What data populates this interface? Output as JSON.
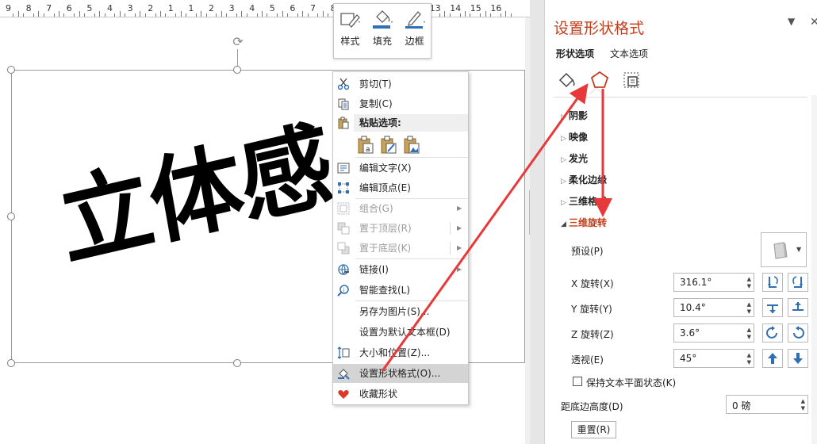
{
  "ruler": {
    "numbers": [
      "9",
      "8",
      "7",
      "6",
      "5",
      "4",
      "3",
      "2",
      "1",
      "1",
      "2",
      "3",
      "4",
      "5",
      "6",
      "7",
      "8",
      "9",
      "10",
      "11",
      "12",
      "13",
      "14",
      "15",
      "16"
    ]
  },
  "slide": {
    "art_text": "立体感"
  },
  "mini_toolbar": {
    "style_label": "样式",
    "fill_label": "填充",
    "outline_label": "边框"
  },
  "context_menu": {
    "cut": "剪切(T)",
    "copy": "复制(C)",
    "paste_options": "粘贴选项:",
    "edit_text": "编辑文字(X)",
    "edit_points": "编辑顶点(E)",
    "group": "组合(G)",
    "bring_front": "置于顶层(R)",
    "send_back": "置于底层(K)",
    "link": "链接(I)",
    "smart_lookup": "智能查找(L)",
    "save_as_picture": "另存为图片(S)...",
    "set_default_textbox": "设置为默认文本框(D)",
    "size_position": "大小和位置(Z)...",
    "format_shape": "设置形状格式(O)...",
    "favorite_shape": "收藏形状"
  },
  "format_pane": {
    "title": "设置形状格式",
    "tab_shape": "形状选项",
    "tab_text": "文本选项",
    "sections": {
      "shadow": "阴影",
      "reflection": "映像",
      "glow": "发光",
      "soft_edges": "柔化边缘",
      "format_3d": "三维格式",
      "rotation_3d": "三维旋转"
    },
    "rotation": {
      "preset_label": "预设(P)",
      "x_label": "X 旋转(X)",
      "x_value": "316.1°",
      "y_label": "Y 旋转(Y)",
      "y_value": "10.4°",
      "z_label": "Z 旋转(Z)",
      "z_value": "3.6°",
      "perspective_label": "透视(E)",
      "perspective_value": "45°",
      "keep_text_flat": "保持文本平面状态(K)",
      "distance_label": "距底边高度(D)",
      "distance_value": "0 磅",
      "reset": "重置(R)"
    }
  },
  "colors": {
    "accent": "#c43e1c",
    "annotation_arrow": "#e8393a",
    "icon_blue": "#2f6fb5"
  },
  "icons": {
    "cut": "scissors-icon",
    "copy": "copy-icon",
    "paste": "clipboard-icon",
    "edit_text": "text-box-icon",
    "edit_points": "edit-points-icon",
    "group": "group-icon",
    "bring_front": "bring-front-icon",
    "send_back": "send-back-icon",
    "link": "link-icon",
    "smart_lookup": "smart-lookup-icon",
    "size_position": "size-position-icon",
    "format_shape": "format-shape-icon",
    "favorite": "heart-icon",
    "fill_line": "paint-bucket-icon",
    "effects": "pentagon-icon",
    "size_props": "size-properties-icon"
  }
}
